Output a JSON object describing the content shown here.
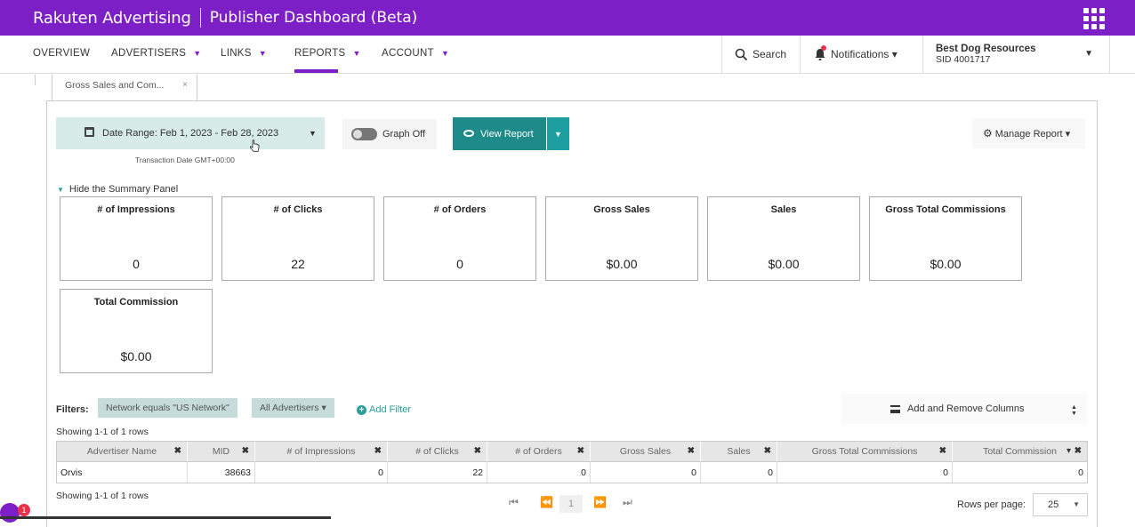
{
  "header": {
    "brand": "Rakuten Advertising",
    "product": "Publisher Dashboard (Beta)",
    "brand_color": "#7d1fc6"
  },
  "nav": {
    "items": [
      {
        "label": "OVERVIEW",
        "has_caret": false
      },
      {
        "label": "ADVERTISERS",
        "has_caret": true
      },
      {
        "label": "LINKS",
        "has_caret": true
      },
      {
        "label": "REPORTS",
        "has_caret": true,
        "active": true
      },
      {
        "label": "ACCOUNT",
        "has_caret": true
      }
    ],
    "caret": "▼",
    "search_label": "Search",
    "notifications_label": "Notifications ▾",
    "account_name": "Best Dog Resources",
    "account_sid": "SID 4001717",
    "account_caret": "▼"
  },
  "tab": {
    "label": "Gross Sales and Com...",
    "close": "×"
  },
  "toolbar": {
    "date_range_label": "Date Range: Feb 1, 2023 - Feb 28, 2023",
    "date_caret": "▼",
    "timezone_note": "Transaction Date GMT+00:00",
    "graph_toggle_label": "Graph Off",
    "view_report_label": "View Report",
    "view_split_caret": "▼",
    "manage_report_label": "Manage Report ▾",
    "gear_glyph": "⚙",
    "accent_color": "#1e8a8a"
  },
  "summary": {
    "toggle_label": "Hide the Summary Panel",
    "toggle_caret": "▼",
    "cards": [
      {
        "title": "# of Impressions",
        "value": "0"
      },
      {
        "title": "# of Clicks",
        "value": "22"
      },
      {
        "title": "# of Orders",
        "value": "0"
      },
      {
        "title": "Gross Sales",
        "value": "$0.00"
      },
      {
        "title": "Sales",
        "value": "$0.00"
      },
      {
        "title": "Gross Total Commissions",
        "value": "$0.00"
      },
      {
        "title": "Total Commission",
        "value": "$0.00"
      }
    ]
  },
  "filters": {
    "label": "Filters:",
    "chips": [
      "Network equals \"US Network\"",
      "All Advertisers ▾"
    ],
    "add_filter_label": "Add Filter",
    "plus_glyph": "+",
    "columns_button_label": "Add and Remove Columns",
    "sort_glyph": "▲▼"
  },
  "table": {
    "showing_top": "Showing 1-1 of 1 rows",
    "showing_bottom": "Showing 1-1 of 1 rows",
    "close_glyph": "✖",
    "columns": [
      "Advertiser Name",
      "MID",
      "# of Impressions",
      "# of Clicks",
      "# of Orders",
      "Gross Sales",
      "Sales",
      "Gross Total Commissions",
      "Total Commission"
    ],
    "sorted_column_marker": "▾",
    "rows": [
      [
        "Orvis",
        "38663",
        "0",
        "22",
        "0",
        "0",
        "0",
        "0",
        "0"
      ]
    ]
  },
  "pagination": {
    "first": "⏮",
    "prev": "⏪",
    "page": "1",
    "next": "⏩",
    "last": "⏭",
    "rows_per_page_label": "Rows per page:",
    "rows_per_page_value": "25",
    "rows_caret": "▼"
  },
  "chat": {
    "badge_count": "1"
  }
}
